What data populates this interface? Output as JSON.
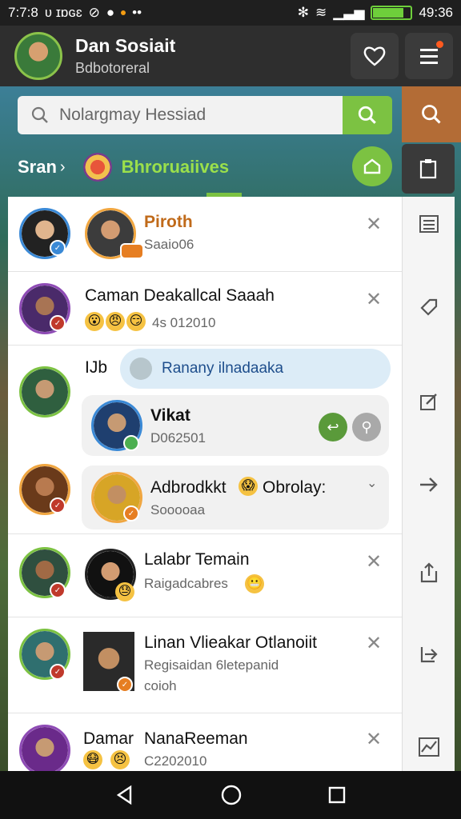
{
  "status_bar": {
    "time": "7:7:8",
    "carrier": "ʋ ɪɒɢɛ",
    "right_time": "49:36",
    "battery_level": 0.82
  },
  "header": {
    "name": "Dan Sosiait",
    "subtitle": "Bdbotoreral"
  },
  "search": {
    "placeholder": "Nolargmay Hessiad"
  },
  "filter": {
    "label": "Sran",
    "title": "Bhroruaiives"
  },
  "rows": [
    {
      "name": "Piroth",
      "sub": "Saaio06"
    },
    {
      "name": "Caman Deakallcal Saaah",
      "sub": "4s 012010"
    },
    {
      "name": "IJb",
      "bubble": "Ranany ilnadaaka"
    },
    {
      "name": "Vikat",
      "sub": "D062501"
    },
    {
      "name": "Adbrodkkt",
      "name_extra": "Obrolay:",
      "sub": "Sooooaa"
    },
    {
      "name": "Lalabr Temain",
      "sub": "Raigadcabres"
    },
    {
      "name": "Linan Vlieakar Otlanoiit",
      "sub": "Regisaidan 6letepanid",
      "sub2": "coioh"
    },
    {
      "name": "Damar",
      "name_extra": "NanaReeman",
      "sub": "C2202010"
    }
  ],
  "colors": {
    "accent": "#7cc242",
    "header_bg": "#2e2e2e",
    "rail_accent": "#b36c36"
  }
}
